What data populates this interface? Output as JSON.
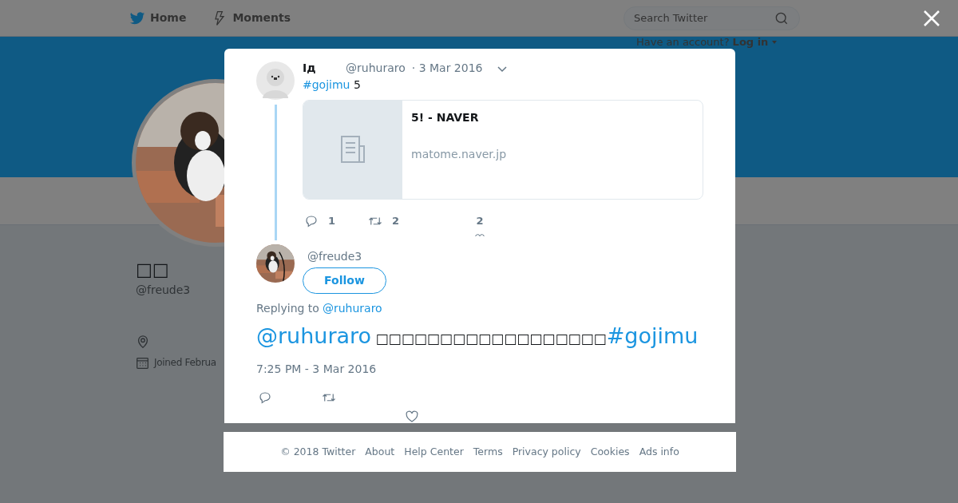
{
  "topbar": {
    "nav": [
      {
        "label": "Home"
      },
      {
        "label": "Moments"
      }
    ],
    "search": {
      "placeholder": "Search Twitter"
    },
    "login": {
      "prompt": "Have an account?",
      "link": "Log in"
    }
  },
  "profile": {
    "name": "□□",
    "handle": "@freude3",
    "joined": "Joined Februa"
  },
  "dialog": {
    "parent_tweet": {
      "name": "Iд",
      "handle": "@ruhuraro",
      "time": "· 3 Mar 2016",
      "text": [
        {
          "kind": "hashtag",
          "text": "#gojimu"
        },
        {
          "kind": "plain",
          "text": " 5"
        }
      ],
      "card": {
        "title": "5! - NAVER",
        "domain": "matome.naver.jp"
      },
      "actions": [
        {
          "kind": "reply",
          "count": "1"
        },
        {
          "kind": "retweet",
          "count": "2"
        },
        {
          "kind": "like",
          "count": "2"
        }
      ]
    },
    "tweet": {
      "handle": "@freude3",
      "follow": "Follow",
      "replying_to": "Replying to",
      "reply_target": "@ruhuraro",
      "text": [
        {
          "kind": "mention",
          "text": "@ruhuraro"
        },
        {
          "kind": "plain",
          "text": " □□□□□□□□□□□□□□□□□□"
        },
        {
          "kind": "hashtag",
          "text": "#gojimu"
        }
      ],
      "time": "7:25 PM - 3 Mar 2016",
      "actions": [
        {
          "kind": "reply"
        },
        {
          "kind": "retweet"
        },
        {
          "kind": "like"
        }
      ]
    }
  },
  "footer": [
    "© 2018 Twitter",
    "About",
    "Help Center",
    "Terms",
    "Privacy policy",
    "Cookies",
    "Ads info"
  ]
}
